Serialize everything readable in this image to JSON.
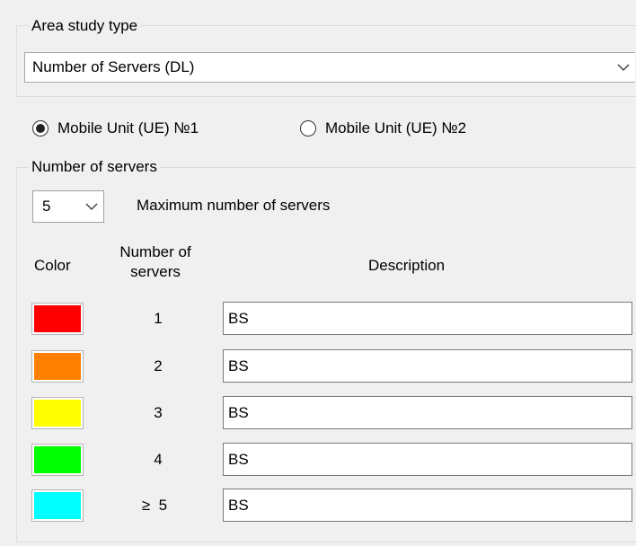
{
  "area_study": {
    "group_label": "Area study type",
    "selected": "Number of Servers (DL)"
  },
  "mobile_units": [
    {
      "label": "Mobile Unit (UE) №1",
      "checked": true
    },
    {
      "label": "Mobile Unit (UE) №2",
      "checked": false
    }
  ],
  "servers": {
    "group_label": "Number of servers",
    "max_value": "5",
    "max_label": "Maximum number of servers",
    "headers": {
      "color": "Color",
      "number_line1": "Number of",
      "number_line2": "servers",
      "description": "Description"
    },
    "rows": [
      {
        "color": "#ff0000",
        "number": "1",
        "description": "BS"
      },
      {
        "color": "#ff8000",
        "number": "2",
        "description": "BS"
      },
      {
        "color": "#ffff00",
        "number": "3",
        "description": "BS"
      },
      {
        "color": "#00ff00",
        "number": "4",
        "description": "BS"
      },
      {
        "color": "#00ffff",
        "number": "≥  5",
        "description": "BS"
      }
    ]
  }
}
